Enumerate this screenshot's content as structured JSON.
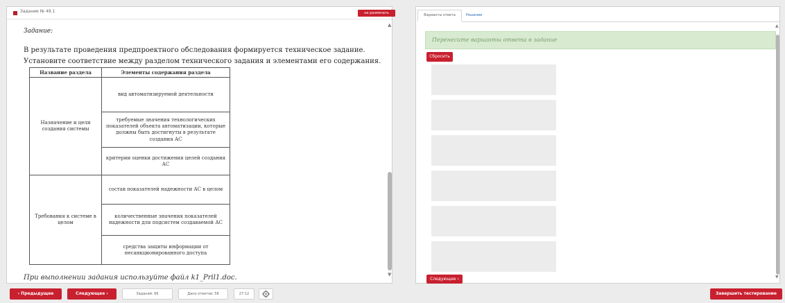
{
  "left_panel": {
    "task_title": "Задание № 49.1",
    "mark_button": "не размечать",
    "zadanie_label": "Задание:",
    "paragraph_1": "В результате проведения предпроектного обследования формируется техническое задание.",
    "paragraph_2": "Установите соответствие между разделом технического задания и элементами его содержания.",
    "table": {
      "headers": [
        "Название раздела",
        "Элементы содержания раздела"
      ],
      "sections": [
        {
          "name": "Назначение и цели создания системы",
          "elements": [
            "вид автоматизируемой деятельности",
            "требуемые значения технологических показателей объекта автоматизации, которые должны быть достигнуты в результате создания АС",
            "критерии оценки достижения целей создания АС"
          ]
        },
        {
          "name": "Требования к системе в целом",
          "elements": [
            "состав показателей надежности АС в целом",
            "количественные значения показателей надежности для подсистем создаваемой АС",
            "средства защиты информации от несанкционированного доступа"
          ]
        }
      ]
    },
    "hint": "При выполнении задания используйте файл k1_Pril1.doc."
  },
  "right_panel": {
    "tabs": [
      "Варианты ответа",
      "Решение"
    ],
    "drag_hint": "Перенесите варианты ответа в задание",
    "reset_button": "Сбросить",
    "next_inline": "Следующее ›"
  },
  "bottom_bar": {
    "prev_button": "‹ Предыдущее",
    "next_button": "Следующее ›",
    "tasks_box": "Заданий: 66",
    "answers_box": "Дано ответов: 58",
    "timer": "27:12",
    "settings_icon": "gear-icon",
    "finish_button": "Завершить тестирование"
  },
  "colors": {
    "accent_red": "#c8202f",
    "hint_green": "#d8ebd0",
    "slot_gray": "#ececec"
  }
}
